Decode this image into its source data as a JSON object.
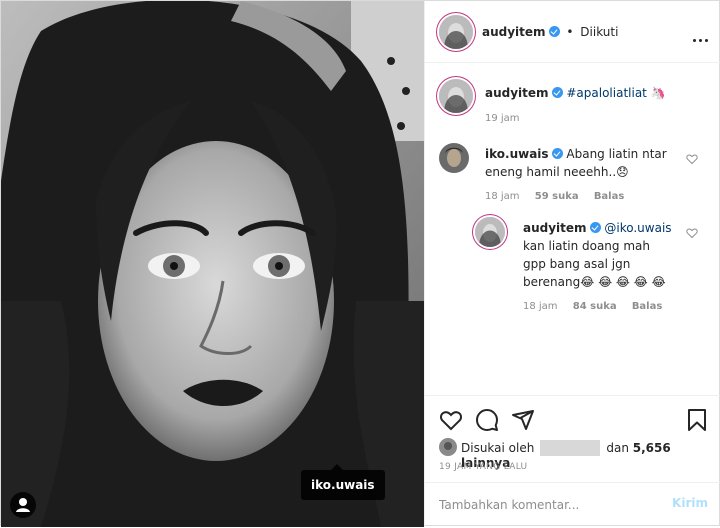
{
  "header": {
    "username": "audyitem",
    "separator": "•",
    "follow_status": "Diikuti"
  },
  "photo": {
    "tag_label": "iko.uwais"
  },
  "caption": {
    "username": "audyitem",
    "hashtag": "#apaloliatliat",
    "emoji": "🦄",
    "time": "19 jam"
  },
  "comments": [
    {
      "username": "iko.uwais",
      "text_line1": "Abang liatin ntar",
      "text_line2": "eneng hamil neeehh..😞",
      "time": "18 jam",
      "likes": "59 suka",
      "reply": "Balas"
    },
    {
      "username": "audyitem",
      "mention": "@iko.uwais",
      "text_line1": "kan liatin doang mah",
      "text_line2": "gpp bang asal jgn",
      "text_line3": "berenang😂 😂 😂 😂 😂",
      "time": "18 jam",
      "likes": "84 suka",
      "reply": "Balas"
    }
  ],
  "likes": {
    "prefix": "Disukai oleh",
    "conjunction": "dan",
    "count": "5,656 lainnya"
  },
  "timestamp": "19 JAM YANG LALU",
  "add_comment": {
    "placeholder": "Tambahkan komentar...",
    "post_label": "Kirim"
  },
  "colors": {
    "link": "#00376b",
    "verified": "#3897f0",
    "muted": "#8e8e8e",
    "post_disabled": "#b2dffc"
  },
  "icons": [
    "heart-icon",
    "comment-icon",
    "share-icon",
    "bookmark-icon",
    "more-icon",
    "user-tag-icon",
    "verified-icon"
  ]
}
